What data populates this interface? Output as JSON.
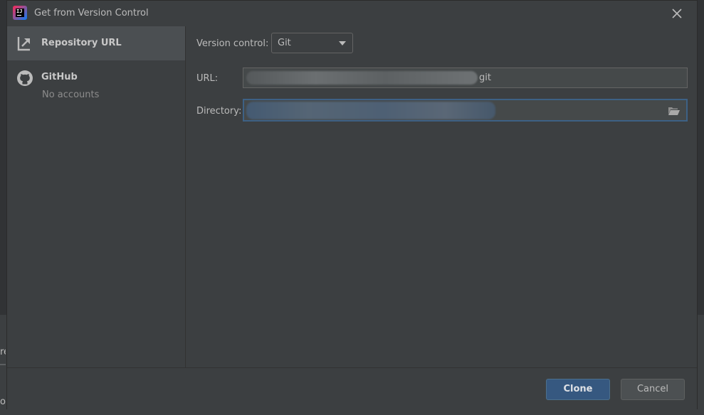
{
  "window": {
    "title": "Get from Version Control"
  },
  "background": {
    "edge_char_1": "re",
    "edge_char_2": "od"
  },
  "sidebar": {
    "items": [
      {
        "label": "Repository URL",
        "selected": true,
        "icon": "vcs-merge-arrow-icon"
      },
      {
        "label": "GitHub",
        "sublabel": "No accounts",
        "selected": false,
        "icon": "github-icon"
      }
    ]
  },
  "form": {
    "version_control_label": "Version control:",
    "version_control_value": "Git",
    "url_label": "URL:",
    "url_value_visible_tail": "git",
    "directory_label": "Directory:"
  },
  "footer": {
    "clone_label": "Clone",
    "cancel_label": "Cancel"
  },
  "colors": {
    "accent": "#365880",
    "focus": "#3d6185",
    "dialog_bg": "#3c3f41",
    "selected_bg": "#4b4f52"
  }
}
